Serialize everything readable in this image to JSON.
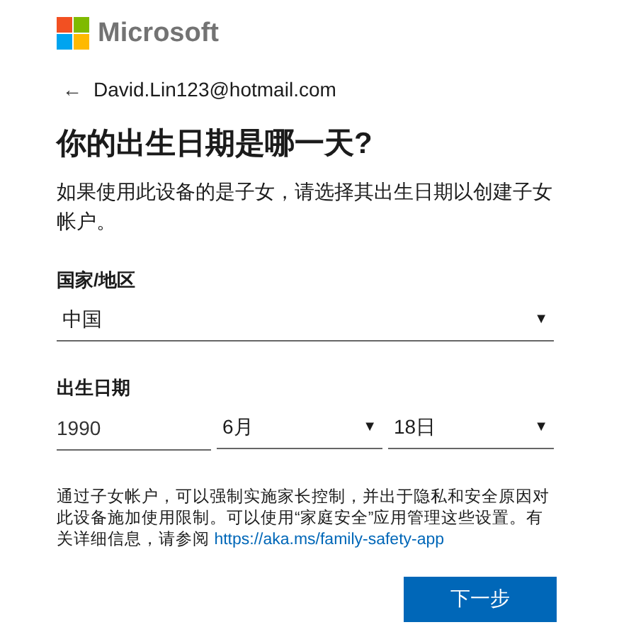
{
  "brand": {
    "name": "Microsoft"
  },
  "back": {
    "arrow": "←",
    "email": "David.Lin123@hotmail.com"
  },
  "heading": "你的出生日期是哪一天?",
  "description": "如果使用此设备的是子女，请选择其出生日期以创建子女帐户。",
  "country": {
    "label": "国家/地区",
    "value": "中国",
    "caret": "▼"
  },
  "birthdate": {
    "label": "出生日期",
    "fields": [
      {
        "kind": "input",
        "value": "1990"
      },
      {
        "kind": "select",
        "value": "6月",
        "caret": "▼"
      },
      {
        "kind": "select",
        "value": "18日",
        "caret": "▼"
      }
    ]
  },
  "note": {
    "text": "通过子女帐户，可以强制实施家长控制，并出于隐私和安全原因对此设备施加使用限制。可以使用“家庭安全”应用管理这些设置。有关详细信息，请参阅",
    "link": "https://aka.ms/family-safety-app"
  },
  "next_button": "下一步"
}
